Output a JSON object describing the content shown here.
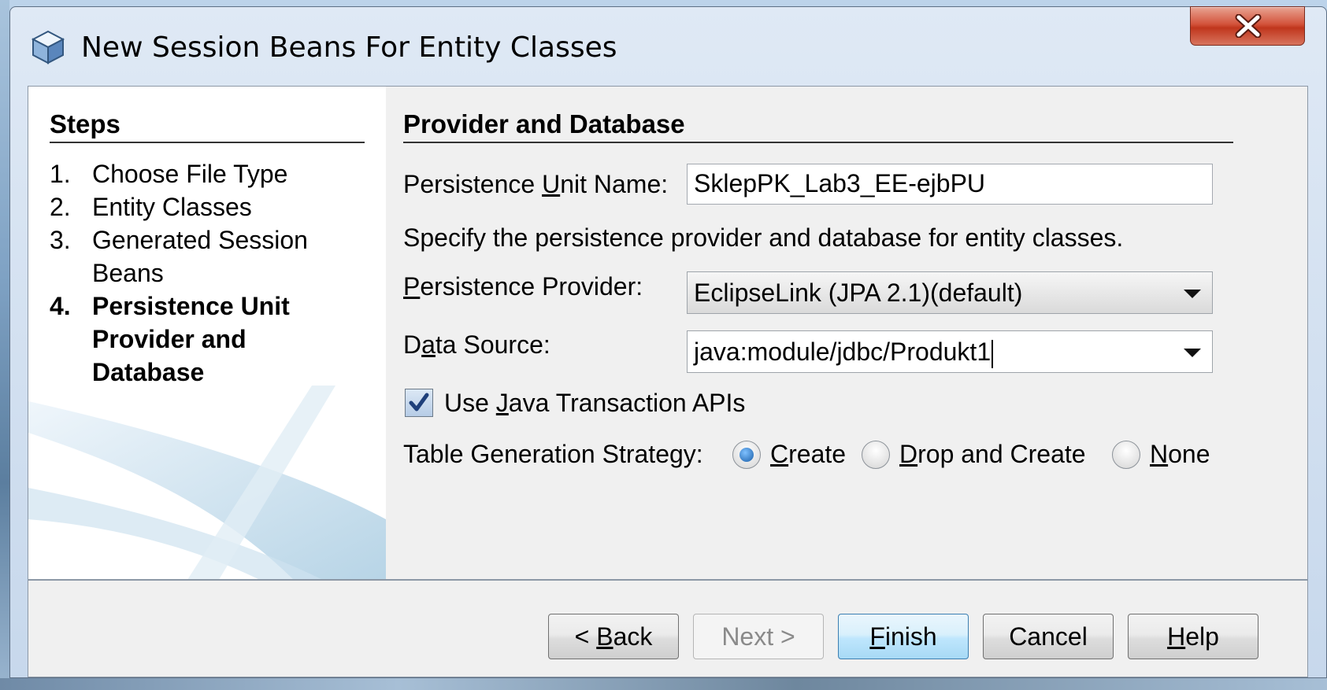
{
  "window": {
    "title": "New Session Beans For Entity Classes",
    "icon": "cube-icon",
    "close_icon": "close-icon"
  },
  "steps": {
    "heading": "Steps",
    "items": [
      {
        "num": "1.",
        "label": "Choose File Type",
        "current": false
      },
      {
        "num": "2.",
        "label": "Entity Classes",
        "current": false
      },
      {
        "num": "3.",
        "label": "Generated Session Beans",
        "current": false
      },
      {
        "num": "4.",
        "label": "Persistence Unit Provider and Database",
        "current": true
      }
    ]
  },
  "main": {
    "heading": "Provider and Database",
    "pu_name_label_pre": "Persistence ",
    "pu_name_label_mn": "U",
    "pu_name_label_post": "nit Name:",
    "pu_name_value": "SklepPK_Lab3_EE-ejbPU",
    "description": "Specify the persistence provider and database for entity classes.",
    "provider_label_mn": "P",
    "provider_label_post": "ersistence Provider:",
    "provider_value": "EclipseLink (JPA 2.1)(default)",
    "datasource_label_pre": "D",
    "datasource_label_mn": "a",
    "datasource_label_post": "ta Source:",
    "datasource_value": "java:module/jdbc/Produkt1",
    "jta_label_pre": "Use ",
    "jta_label_mn": "J",
    "jta_label_post": "ava Transaction APIs",
    "jta_checked": true,
    "table_gen_label": "Table Generation Strategy:",
    "table_gen_options": [
      {
        "mn": "C",
        "rest": "reate",
        "selected": true
      },
      {
        "mn": "D",
        "rest": "rop and Create",
        "selected": false
      },
      {
        "mn": "N",
        "rest": "one",
        "selected": false
      }
    ]
  },
  "buttons": {
    "back_pre": "< ",
    "back_mn": "B",
    "back_post": "ack",
    "next": "Next >",
    "finish_mn": "F",
    "finish_post": "inish",
    "cancel": "Cancel",
    "help_mn": "H",
    "help_post": "elp"
  }
}
